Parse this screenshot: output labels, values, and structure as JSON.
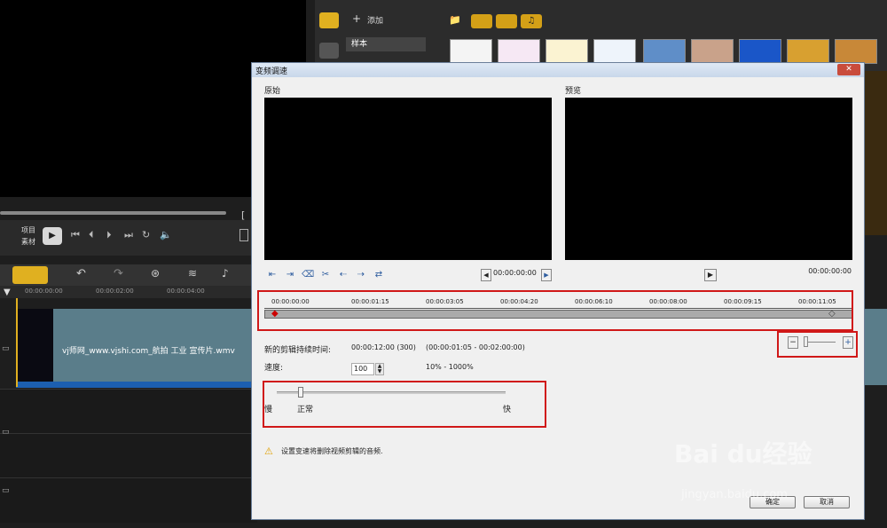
{
  "editor": {
    "playback_labels": {
      "project": "项目",
      "clip": "素材"
    },
    "library": {
      "add_label": "添加",
      "sample_tab": "样本"
    },
    "timeline": {
      "ruler": [
        "00:00:00:00",
        "00:00:02:00",
        "00:00:04:00"
      ],
      "clip_label": "vj师网_www.vjshi.com_航拍 工业 宣传片.wmv"
    }
  },
  "dialog": {
    "title": "变频调速",
    "close_label": "✕",
    "original_label": "原始",
    "preview_label": "预览",
    "original_time": "00:00:00:00",
    "preview_time": "00:00:00:00",
    "timeline_ticks": [
      "00:00:00:00",
      "00:00:01:15",
      "00:00:03:05",
      "00:00:04:20",
      "00:00:06:10",
      "00:00:08:00",
      "00:00:09:15",
      "00:00:11:05"
    ],
    "new_duration_label": "新的剪辑持续时间:",
    "new_duration_value": "00:00:12:00 (300)",
    "duration_range": "(00:00:01:05 - 00:02:00:00)",
    "speed_label": "速度:",
    "speed_value": "100",
    "speed_range": "10% - 1000%",
    "slider_labels": {
      "slow": "慢",
      "normal": "正常",
      "fast": "快"
    },
    "zoom_minus": "−",
    "zoom_plus": "+",
    "warning_text": "设置变速将删除视频剪辑的音频.",
    "ok_label": "确定",
    "cancel_label": "取消"
  },
  "watermark": {
    "brand": "Bai du经验",
    "url": "jingyan.baidu.com"
  },
  "colors": {
    "accent": "#e0b020",
    "highlight_box": "#d01818",
    "clip_bar": "#1c5fb0"
  }
}
